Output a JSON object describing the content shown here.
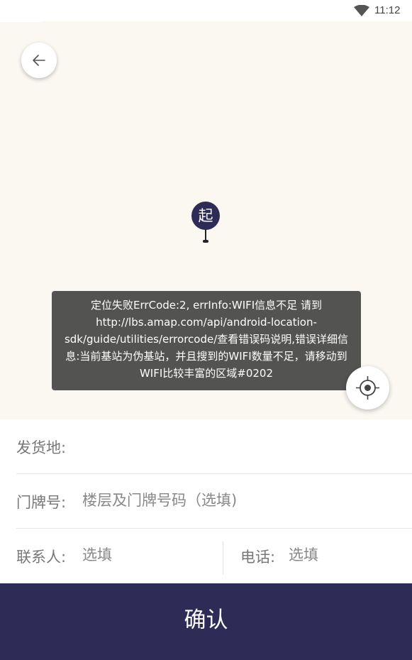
{
  "status_bar": {
    "time": "11:12",
    "icons": [
      "wifi-icon"
    ]
  },
  "map": {
    "start_marker_label": "起",
    "back_icon": "arrow-left-icon",
    "locate_icon": "location-target-icon",
    "toast_message": "定位失败ErrCode:2, errInfo:WIFI信息不足 请到http://lbs.amap.com/api/android-location-sdk/guide/utilities/errorcode/查看错误码说明,错误详细信息:当前基站为伪基站，并且搜到的WIFI数量不足，请移动到WIFI比较丰富的区域#0202"
  },
  "form": {
    "origin_label": "发货地:",
    "origin_value": "",
    "house_number_label": "门牌号:",
    "house_number_placeholder": "楼层及门牌号码（选填)",
    "contact_label": "联系人:",
    "contact_placeholder": "选填",
    "phone_label": "电话:",
    "phone_placeholder": "选填"
  },
  "confirm_button": {
    "label": "确认"
  },
  "colors": {
    "primary": "#2e2b57",
    "map_background": "#fbf8f2",
    "toast_background": "#464646"
  }
}
